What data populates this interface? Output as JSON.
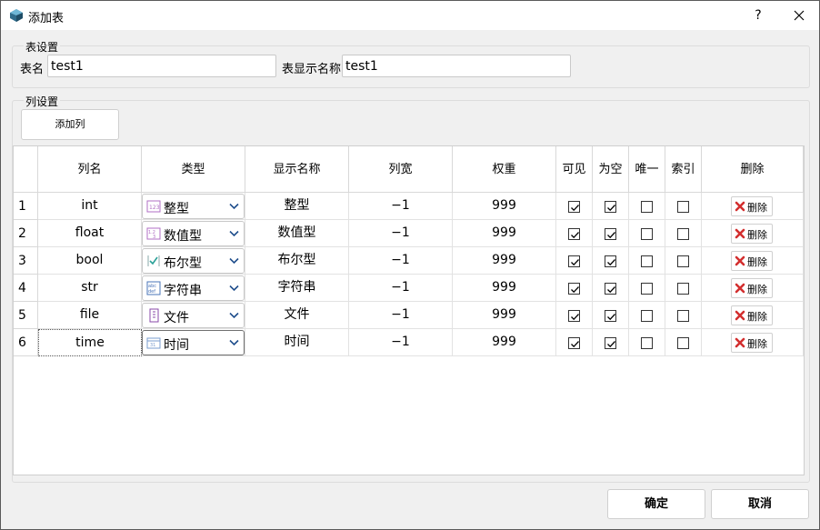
{
  "window": {
    "title": "添加表",
    "help": "?"
  },
  "table_settings": {
    "legend": "表设置",
    "name_label": "表名",
    "name_value": "test1",
    "display_label": "表显示名称",
    "display_value": "test1"
  },
  "column_settings": {
    "legend": "列设置",
    "add_button": "添加列",
    "headers": [
      "列名",
      "类型",
      "显示名称",
      "列宽",
      "权重",
      "可见",
      "为空",
      "唯一",
      "索引",
      "删除"
    ],
    "rows": [
      {
        "num": "1",
        "name": "int",
        "type": "整型",
        "type_icon": "integer-type-icon",
        "display": "整型",
        "width": "−1",
        "weight": "999",
        "visible": true,
        "nullable": true,
        "unique": false,
        "index": false,
        "delete": "删除"
      },
      {
        "num": "2",
        "name": "float",
        "type": "数值型",
        "type_icon": "number-type-icon",
        "display": "数值型",
        "width": "−1",
        "weight": "999",
        "visible": true,
        "nullable": true,
        "unique": false,
        "index": false,
        "delete": "删除"
      },
      {
        "num": "3",
        "name": "bool",
        "type": "布尔型",
        "type_icon": "boolean-type-icon",
        "display": "布尔型",
        "width": "−1",
        "weight": "999",
        "visible": true,
        "nullable": true,
        "unique": false,
        "index": false,
        "delete": "删除"
      },
      {
        "num": "4",
        "name": "str",
        "type": "字符串",
        "type_icon": "string-type-icon",
        "display": "字符串",
        "width": "−1",
        "weight": "999",
        "visible": true,
        "nullable": true,
        "unique": false,
        "index": false,
        "delete": "删除"
      },
      {
        "num": "5",
        "name": "file",
        "type": "文件",
        "type_icon": "file-type-icon",
        "display": "文件",
        "width": "−1",
        "weight": "999",
        "visible": true,
        "nullable": true,
        "unique": false,
        "index": false,
        "delete": "删除"
      },
      {
        "num": "6",
        "name": "time",
        "type": "时间",
        "type_icon": "time-type-icon",
        "display": "时间",
        "width": "−1",
        "weight": "999",
        "visible": true,
        "nullable": true,
        "unique": false,
        "index": false,
        "delete": "删除"
      }
    ]
  },
  "footer": {
    "ok": "确定",
    "cancel": "取消"
  },
  "colors": {
    "delete_icon": "#d32f2f",
    "accent": "#1f6fd1"
  }
}
